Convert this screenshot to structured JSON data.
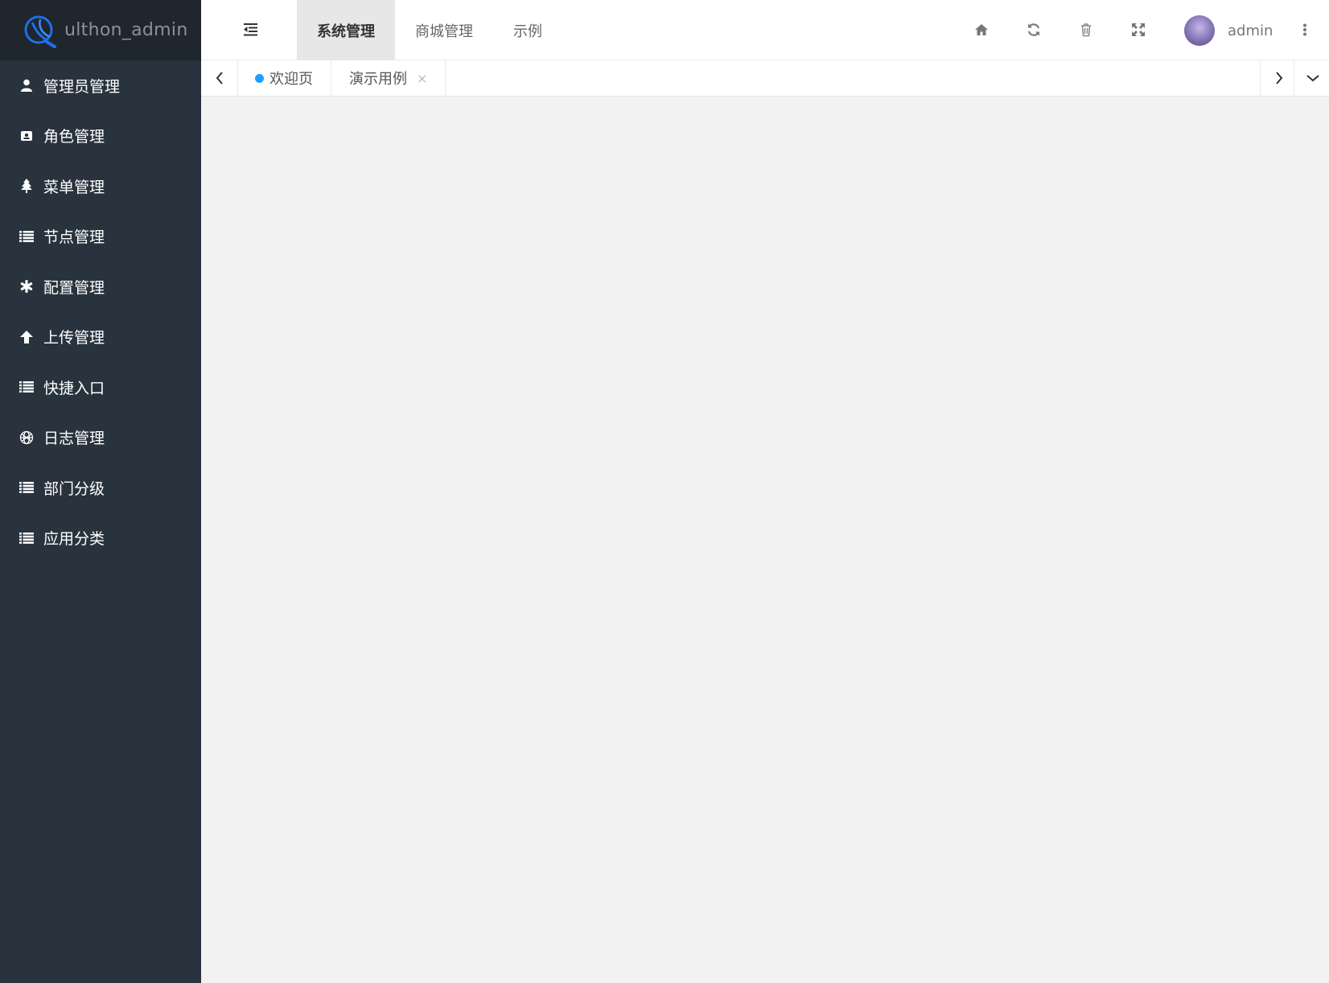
{
  "brand": {
    "name": "ulthon_admin"
  },
  "sidebar": {
    "items": [
      {
        "label": "管理员管理",
        "icon": "user-icon"
      },
      {
        "label": "角色管理",
        "icon": "id-card-icon"
      },
      {
        "label": "菜单管理",
        "icon": "tree-icon"
      },
      {
        "label": "节点管理",
        "icon": "list-icon"
      },
      {
        "label": "配置管理",
        "icon": "asterisk-icon"
      },
      {
        "label": "上传管理",
        "icon": "arrow-up-icon"
      },
      {
        "label": "快捷入口",
        "icon": "list-icon"
      },
      {
        "label": "日志管理",
        "icon": "globe-icon"
      },
      {
        "label": "部门分级",
        "icon": "list-icon"
      },
      {
        "label": "应用分类",
        "icon": "list-icon"
      }
    ]
  },
  "header": {
    "nav": [
      {
        "label": "系统管理",
        "active": true
      },
      {
        "label": "商城管理",
        "active": false
      },
      {
        "label": "示例",
        "active": false
      }
    ],
    "tools": [
      "home-icon",
      "refresh-icon",
      "trash-icon",
      "fullscreen-icon"
    ],
    "user": {
      "name": "admin"
    }
  },
  "tabs": {
    "items": [
      {
        "label": "欢迎页",
        "home": true
      },
      {
        "label": "演示用例",
        "closable": true,
        "close_label": "×"
      }
    ]
  },
  "colors": {
    "sidebar_bg": "#28333e",
    "logo_bg": "#1f262d",
    "accent": "#1e9fff",
    "content_bg": "#f2f2f2"
  }
}
